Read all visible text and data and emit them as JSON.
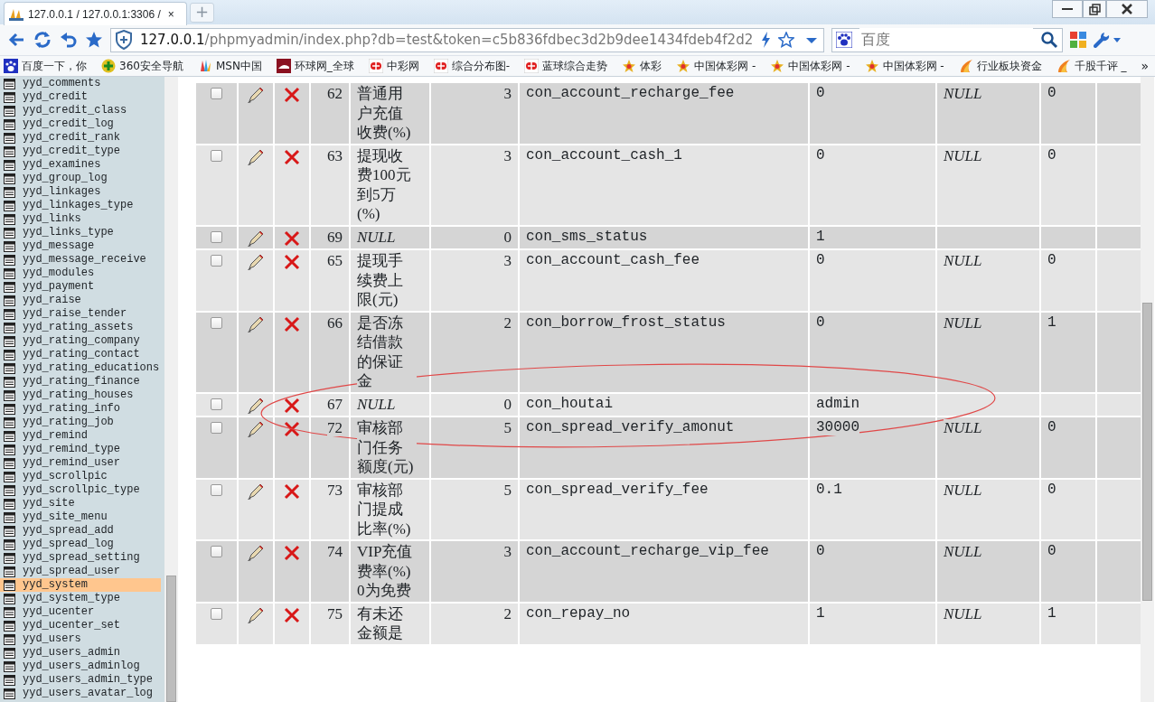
{
  "browser": {
    "tab": {
      "title": "127.0.0.1 / 127.0.0.1:3306 /",
      "close": "×"
    },
    "new_tab": "+",
    "address": {
      "host": "127.0.0.1",
      "path": "/phpmyadmin/index.php?db=test&token=c5b836fdbec3d2b9dee1434fdeb4f2d2"
    },
    "search": {
      "placeholder": "百度"
    },
    "bookmarks": [
      {
        "label": "百度一下，你",
        "kind": "paw"
      },
      {
        "label": "360安全导航",
        "kind": "plus"
      },
      {
        "label": "MSN中国",
        "kind": "msn"
      },
      {
        "label": "环球网_全球",
        "kind": "flag"
      },
      {
        "label": "中彩网",
        "kind": "lottery"
      },
      {
        "label": "综合分布图-",
        "kind": "lottery"
      },
      {
        "label": "蓝球综合走势",
        "kind": "lottery"
      },
      {
        "label": "体彩",
        "kind": "star"
      },
      {
        "label": "中国体彩网 -",
        "kind": "star"
      },
      {
        "label": "中国体彩网 -",
        "kind": "star"
      },
      {
        "label": "中国体彩网 -",
        "kind": "star"
      },
      {
        "label": "行业板块资金",
        "kind": "flame"
      },
      {
        "label": "千股千评 _",
        "kind": "flame"
      }
    ],
    "bookmarks_more": "»"
  },
  "sidebar": {
    "tables": [
      {
        "name": "yyd_comments",
        "selected": false
      },
      {
        "name": "yyd_credit",
        "selected": false
      },
      {
        "name": "yyd_credit_class",
        "selected": false
      },
      {
        "name": "yyd_credit_log",
        "selected": false
      },
      {
        "name": "yyd_credit_rank",
        "selected": false
      },
      {
        "name": "yyd_credit_type",
        "selected": false
      },
      {
        "name": "yyd_examines",
        "selected": false
      },
      {
        "name": "yyd_group_log",
        "selected": false
      },
      {
        "name": "yyd_linkages",
        "selected": false
      },
      {
        "name": "yyd_linkages_type",
        "selected": false
      },
      {
        "name": "yyd_links",
        "selected": false
      },
      {
        "name": "yyd_links_type",
        "selected": false
      },
      {
        "name": "yyd_message",
        "selected": false
      },
      {
        "name": "yyd_message_receive",
        "selected": false
      },
      {
        "name": "yyd_modules",
        "selected": false
      },
      {
        "name": "yyd_payment",
        "selected": false
      },
      {
        "name": "yyd_raise",
        "selected": false
      },
      {
        "name": "yyd_raise_tender",
        "selected": false
      },
      {
        "name": "yyd_rating_assets",
        "selected": false
      },
      {
        "name": "yyd_rating_company",
        "selected": false
      },
      {
        "name": "yyd_rating_contact",
        "selected": false
      },
      {
        "name": "yyd_rating_educations",
        "selected": false
      },
      {
        "name": "yyd_rating_finance",
        "selected": false
      },
      {
        "name": "yyd_rating_houses",
        "selected": false
      },
      {
        "name": "yyd_rating_info",
        "selected": false
      },
      {
        "name": "yyd_rating_job",
        "selected": false
      },
      {
        "name": "yyd_remind",
        "selected": false
      },
      {
        "name": "yyd_remind_type",
        "selected": false
      },
      {
        "name": "yyd_remind_user",
        "selected": false
      },
      {
        "name": "yyd_scrollpic",
        "selected": false
      },
      {
        "name": "yyd_scrollpic_type",
        "selected": false
      },
      {
        "name": "yyd_site",
        "selected": false
      },
      {
        "name": "yyd_site_menu",
        "selected": false
      },
      {
        "name": "yyd_spread_add",
        "selected": false
      },
      {
        "name": "yyd_spread_log",
        "selected": false
      },
      {
        "name": "yyd_spread_setting",
        "selected": false
      },
      {
        "name": "yyd_spread_user",
        "selected": false
      },
      {
        "name": "yyd_system",
        "selected": true
      },
      {
        "name": "yyd_system_type",
        "selected": false
      },
      {
        "name": "yyd_ucenter",
        "selected": false
      },
      {
        "name": "yyd_ucenter_set",
        "selected": false
      },
      {
        "name": "yyd_users",
        "selected": false
      },
      {
        "name": "yyd_users_admin",
        "selected": false
      },
      {
        "name": "yyd_users_adminlog",
        "selected": false
      },
      {
        "name": "yyd_users_admin_type",
        "selected": false
      },
      {
        "name": "yyd_users_avatar_log",
        "selected": false
      }
    ]
  },
  "table": {
    "rows": [
      {
        "checked": false,
        "cells": [
          {
            "text": "62",
            "italic": false
          },
          {
            "text": "普通用户充值收费(%)",
            "italic": false
          },
          {
            "text": "3",
            "italic": false
          },
          {
            "text": "con_account_recharge_fee",
            "italic": false
          },
          {
            "text": "0",
            "italic": false
          },
          {
            "text": "NULL",
            "italic": true
          },
          {
            "text": "0",
            "italic": false
          }
        ]
      },
      {
        "checked": false,
        "cells": [
          {
            "text": "63",
            "italic": false
          },
          {
            "text": "提现收费100元到5万(%)",
            "italic": false
          },
          {
            "text": "3",
            "italic": false
          },
          {
            "text": "con_account_cash_1",
            "italic": false
          },
          {
            "text": "0",
            "italic": false
          },
          {
            "text": "NULL",
            "italic": true
          },
          {
            "text": "0",
            "italic": false
          }
        ]
      },
      {
        "checked": false,
        "cells": [
          {
            "text": "69",
            "italic": false
          },
          {
            "text": "NULL",
            "italic": true
          },
          {
            "text": "0",
            "italic": false
          },
          {
            "text": "con_sms_status",
            "italic": false
          },
          {
            "text": "1",
            "italic": false
          }
        ]
      },
      {
        "checked": false,
        "cells": [
          {
            "text": "65",
            "italic": false
          },
          {
            "text": "提现手续费上限(元)",
            "italic": false
          },
          {
            "text": "3",
            "italic": false
          },
          {
            "text": "con_account_cash_fee",
            "italic": false
          },
          {
            "text": "0",
            "italic": false
          },
          {
            "text": "NULL",
            "italic": true
          },
          {
            "text": "0",
            "italic": false
          }
        ]
      },
      {
        "checked": false,
        "cells": [
          {
            "text": "66",
            "italic": false
          },
          {
            "text": "是否冻结借款的保证金",
            "italic": false
          },
          {
            "text": "2",
            "italic": false
          },
          {
            "text": "con_borrow_frost_status",
            "italic": false
          },
          {
            "text": "0",
            "italic": false
          },
          {
            "text": "NULL",
            "italic": true
          },
          {
            "text": "1",
            "italic": false
          }
        ]
      },
      {
        "checked": false,
        "cells": [
          {
            "text": "67",
            "italic": false
          },
          {
            "text": "NULL",
            "italic": true
          },
          {
            "text": "0",
            "italic": false
          },
          {
            "text": "con_houtai",
            "italic": false
          },
          {
            "text": "admin",
            "italic": false
          }
        ]
      },
      {
        "checked": false,
        "cells": [
          {
            "text": "72",
            "italic": false
          },
          {
            "text": "审核部门任务额度(元)",
            "italic": false
          },
          {
            "text": "5",
            "italic": false
          },
          {
            "text": "con_spread_verify_amonut",
            "italic": false
          },
          {
            "text": "30000",
            "italic": false
          },
          {
            "text": "NULL",
            "italic": true
          },
          {
            "text": "0",
            "italic": false
          }
        ]
      },
      {
        "checked": false,
        "cells": [
          {
            "text": "73",
            "italic": false
          },
          {
            "text": "审核部门提成比率(%)",
            "italic": false
          },
          {
            "text": "5",
            "italic": false
          },
          {
            "text": "con_spread_verify_fee",
            "italic": false
          },
          {
            "text": "0.1",
            "italic": false
          },
          {
            "text": "NULL",
            "italic": true
          },
          {
            "text": "0",
            "italic": false
          }
        ]
      },
      {
        "checked": false,
        "cells": [
          {
            "text": "74",
            "italic": false
          },
          {
            "text": "VIP充值费率(%)0为免费",
            "italic": false
          },
          {
            "text": "3",
            "italic": false
          },
          {
            "text": "con_account_recharge_vip_fee",
            "italic": false
          },
          {
            "text": "0",
            "italic": false
          },
          {
            "text": "NULL",
            "italic": true
          },
          {
            "text": "0",
            "italic": false
          }
        ]
      },
      {
        "checked": false,
        "cells": [
          {
            "text": "75",
            "italic": false
          },
          {
            "text": "有未还金额是",
            "italic": false
          },
          {
            "text": "2",
            "italic": false
          },
          {
            "text": "con_repay_no",
            "italic": false
          },
          {
            "text": "1",
            "italic": false
          },
          {
            "text": "NULL",
            "italic": true
          },
          {
            "text": "1",
            "italic": false
          }
        ]
      }
    ]
  },
  "annotations": [
    {
      "kind": "ellipse"
    }
  ]
}
